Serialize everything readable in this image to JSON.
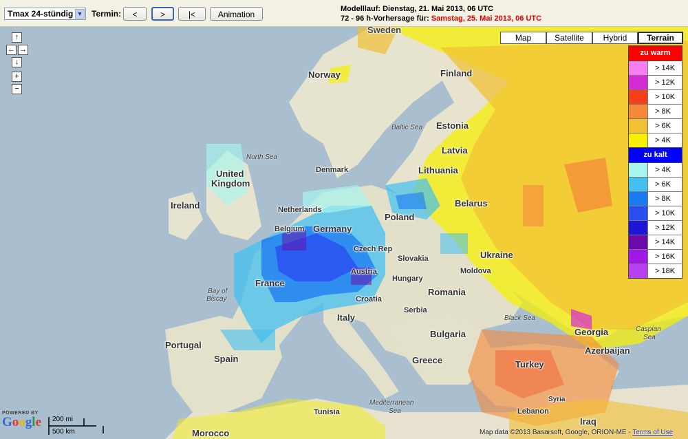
{
  "toolbar": {
    "product_select": "Tmax 24-stündig",
    "termin_label": "Termin:",
    "prev_button": "<",
    "next_button": ">",
    "first_button": "|<",
    "animation_button": "Animation",
    "run_line_1": "Modelllauf: Dienstag, 21. Mai 2013, 06 UTC",
    "run_line_2_prefix": "72 - 96 h-Vorhersage für:",
    "run_line_2_date": "Samstag, 25. Mai 2013, 06 UTC"
  },
  "map_types": [
    "Map",
    "Satellite",
    "Hybrid",
    "Terrain"
  ],
  "selected_map_type": "Terrain",
  "nav": {
    "up": "↑",
    "left": "←",
    "right": "→",
    "down": "↓",
    "zoom_in": "+",
    "zoom_out": "−"
  },
  "places": {
    "sweden": "Sweden",
    "norway": "Norway",
    "finland": "Finland",
    "estonia": "Estonia",
    "latvia": "Latvia",
    "lithuania": "Lithuania",
    "belarus": "Belarus",
    "denmark": "Denmark",
    "united": "United",
    "kingdom": "Kingdom",
    "ireland": "Ireland",
    "netherlands": "Netherlands",
    "belgium": "Belgium",
    "germany": "Germany",
    "poland": "Poland",
    "czech": "Czech Rep",
    "slovakia": "Slovakia",
    "ukraine": "Ukraine",
    "moldova": "Moldova",
    "austria": "Austria",
    "hungary": "Hungary",
    "france": "France",
    "croatia": "Croatia",
    "romania": "Romania",
    "serbia": "Serbia",
    "italy": "Italy",
    "bulgaria": "Bulgaria",
    "portugal": "Portugal",
    "spain": "Spain",
    "greece": "Greece",
    "turkey": "Turkey",
    "georgia": "Georgia",
    "azerbaijan": "Azerbaijan",
    "syria": "Syria",
    "lebanon": "Lebanon",
    "iraq": "Iraq",
    "tunisia": "Tunisia",
    "morocco": "Morocco"
  },
  "seas": {
    "north_sea": "North Sea",
    "baltic_sea": "Baltic Sea",
    "bay_of": "Bay of",
    "biscay": "Biscay",
    "black_sea": "Black Sea",
    "caspian": "Caspian",
    "caspian_sea": "Sea",
    "mediterranean": "Mediterranean",
    "mediterranean_sea": "Sea"
  },
  "legend": {
    "warm_title": "zu warm",
    "warm": [
      {
        "label": "> 14K",
        "color": "#f77ef0"
      },
      {
        "label": "> 12K",
        "color": "#d42bd6"
      },
      {
        "label": "> 10K",
        "color": "#f2401a"
      },
      {
        "label": "> 8K",
        "color": "#f5893a"
      },
      {
        "label": "> 6K",
        "color": "#f1c033"
      },
      {
        "label": "> 4K",
        "color": "#f7f000"
      }
    ],
    "cold_title": "zu kalt",
    "cold": [
      {
        "label": "> 4K",
        "color": "#a8f4ee"
      },
      {
        "label": "> 6K",
        "color": "#43c0f0"
      },
      {
        "label": "> 8K",
        "color": "#1a7af2"
      },
      {
        "label": "> 10K",
        "color": "#2a4df0"
      },
      {
        "label": "> 12K",
        "color": "#1c16d8"
      },
      {
        "label": "> 14K",
        "color": "#6a0aa8"
      },
      {
        "label": "> 16K",
        "color": "#9f18e8"
      },
      {
        "label": "> 18K",
        "color": "#b63ff0"
      }
    ]
  },
  "footer": {
    "powered_by": "POWERED BY",
    "google": "Google",
    "scale_mi": "200 mi",
    "scale_km": "500 km",
    "attribution": "Map data ©2013 Basarsoft, Google, ORION-ME -",
    "terms": "Terms of Use"
  },
  "colors": {
    "warm_header": "#ff0000",
    "cold_header": "#0000ff",
    "sea": "#a9bfcf",
    "land": "#e8e5d3"
  }
}
